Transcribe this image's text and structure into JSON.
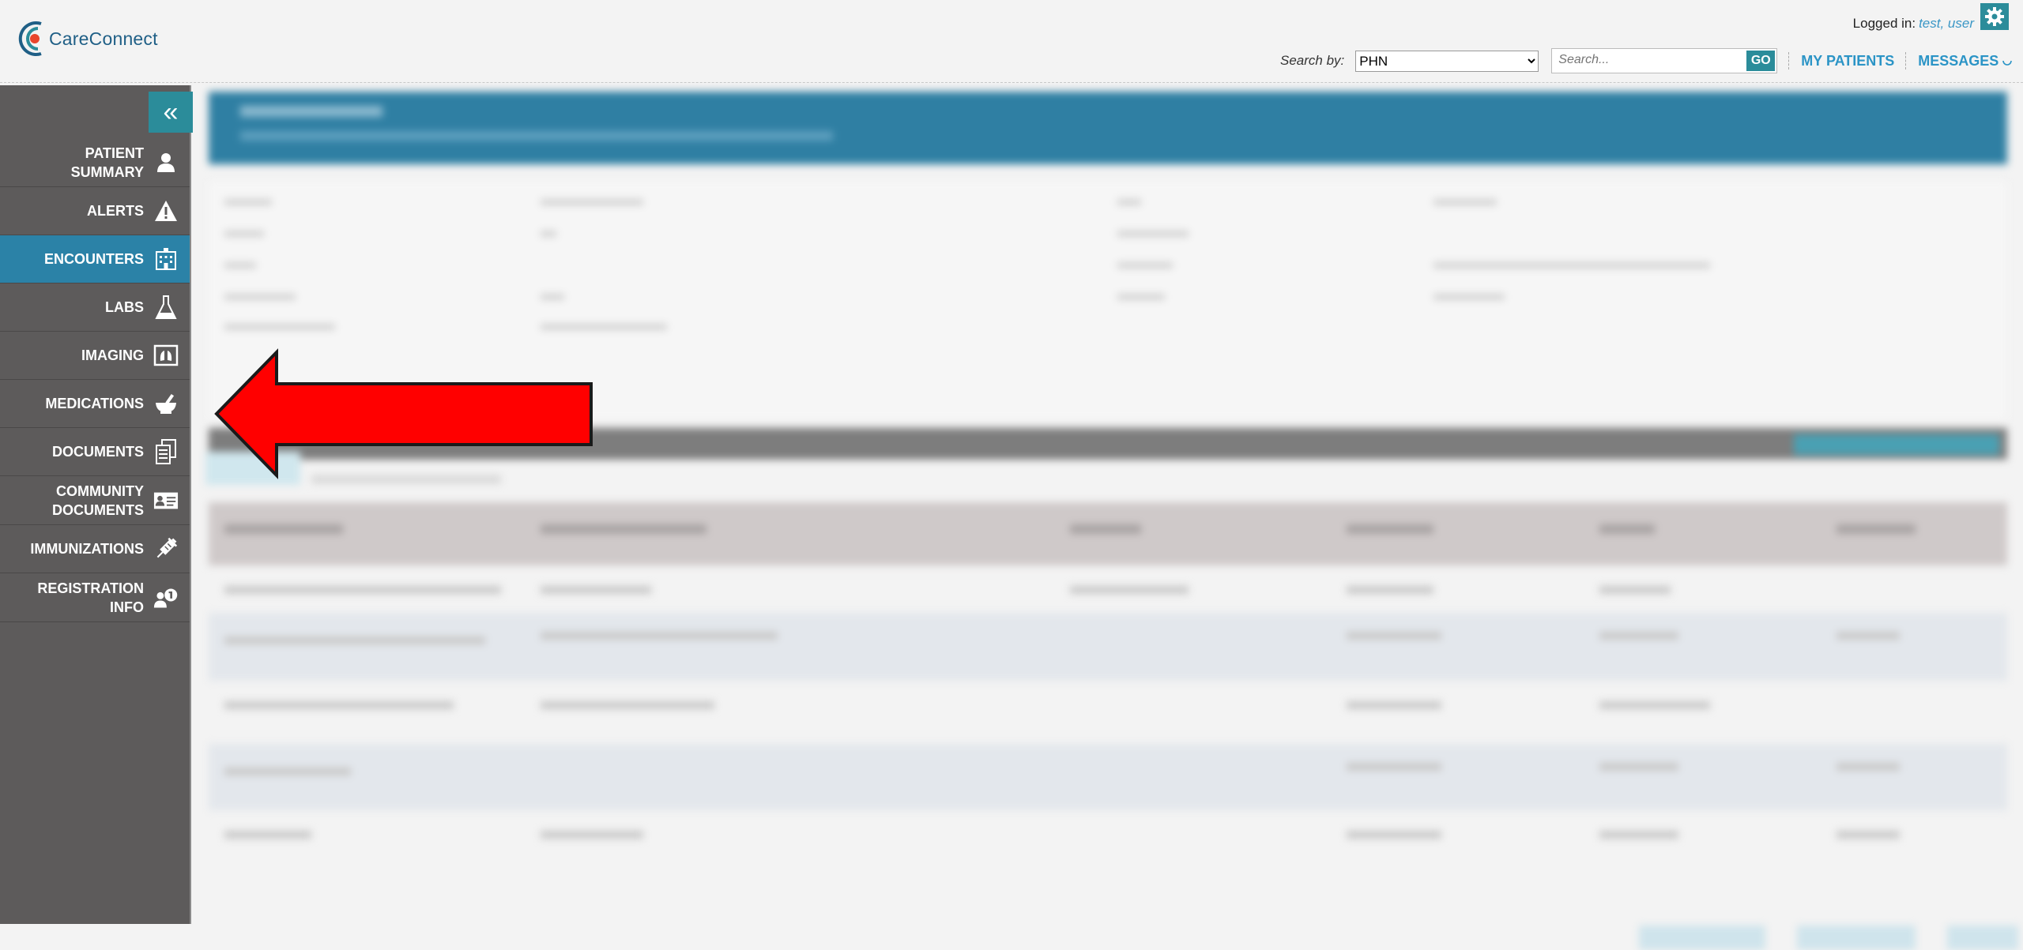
{
  "app": {
    "name": "CareConnect"
  },
  "header": {
    "logged_in_label": "Logged in:",
    "logged_in_user": "test, user",
    "search_by_label": "Search by:",
    "search_by_value": "PHN",
    "search_placeholder": "Search...",
    "go_label": "GO",
    "my_patients_label": "MY PATIENTS",
    "messages_label": "MESSAGES",
    "messages_count_icon": "spinner-icon"
  },
  "sidebar": {
    "collapse_label": "«",
    "items": [
      {
        "label": "PATIENT SUMMARY",
        "icon": "person-icon",
        "active": false
      },
      {
        "label": "ALERTS",
        "icon": "warning-icon",
        "active": false
      },
      {
        "label": "ENCOUNTERS",
        "icon": "hospital-icon",
        "active": true
      },
      {
        "label": "LABS",
        "icon": "flask-icon",
        "active": false
      },
      {
        "label": "IMAGING",
        "icon": "xray-icon",
        "active": false
      },
      {
        "label": "MEDICATIONS",
        "icon": "mortar-pestle-icon",
        "active": false
      },
      {
        "label": "DOCUMENTS",
        "icon": "documents-icon",
        "active": false
      },
      {
        "label": "COMMUNITY DOCUMENTS",
        "icon": "id-card-icon",
        "active": false
      },
      {
        "label": "IMMUNIZATIONS",
        "icon": "syringe-icon",
        "active": false
      },
      {
        "label": "REGISTRATION INFO",
        "icon": "registration-icon",
        "active": false
      }
    ]
  },
  "annotation": {
    "arrow_color": "#ff0000",
    "arrow_target": "MEDICATIONS"
  },
  "colors": {
    "teal": "#2b8c9a",
    "active_nav": "#2b82a7",
    "sidebar_bg": "#5d5b5b",
    "link_blue": "#2b94c6"
  }
}
